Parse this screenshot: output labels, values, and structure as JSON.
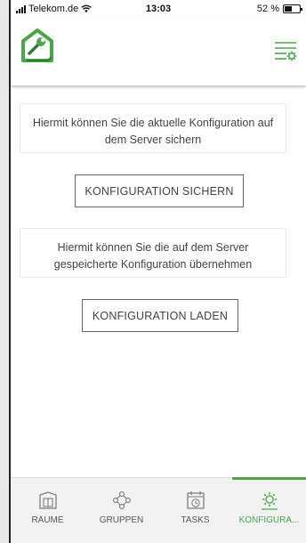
{
  "status_bar": {
    "carrier": "Telekom.de",
    "time": "13:03",
    "battery_text": "52 %",
    "battery_level": 0.52
  },
  "header": {
    "logo_icon": "house-wrench-logo",
    "menu_icon": "menu-settings-icon"
  },
  "colors": {
    "accent": "#49a749",
    "text": "#444444"
  },
  "main": {
    "save_info": "Hiermit können Sie die aktuelle Konfiguration auf dem Server sichern",
    "save_button": "KONFIGURATION SICHERN",
    "load_info": "Hiermit können Sie die auf dem Server gespeicherte Konfiguration übernehmen",
    "load_button": "KONFIGURATION LADEN"
  },
  "tabbar": {
    "tabs": [
      {
        "label": "RÄUME",
        "icon": "rooms-icon",
        "active": false
      },
      {
        "label": "GRUPPEN",
        "icon": "groups-icon",
        "active": false
      },
      {
        "label": "TASKS",
        "icon": "tasks-clock-icon",
        "active": false
      },
      {
        "label": "KONFIGURA...",
        "icon": "config-gear-icon",
        "active": true
      }
    ]
  }
}
